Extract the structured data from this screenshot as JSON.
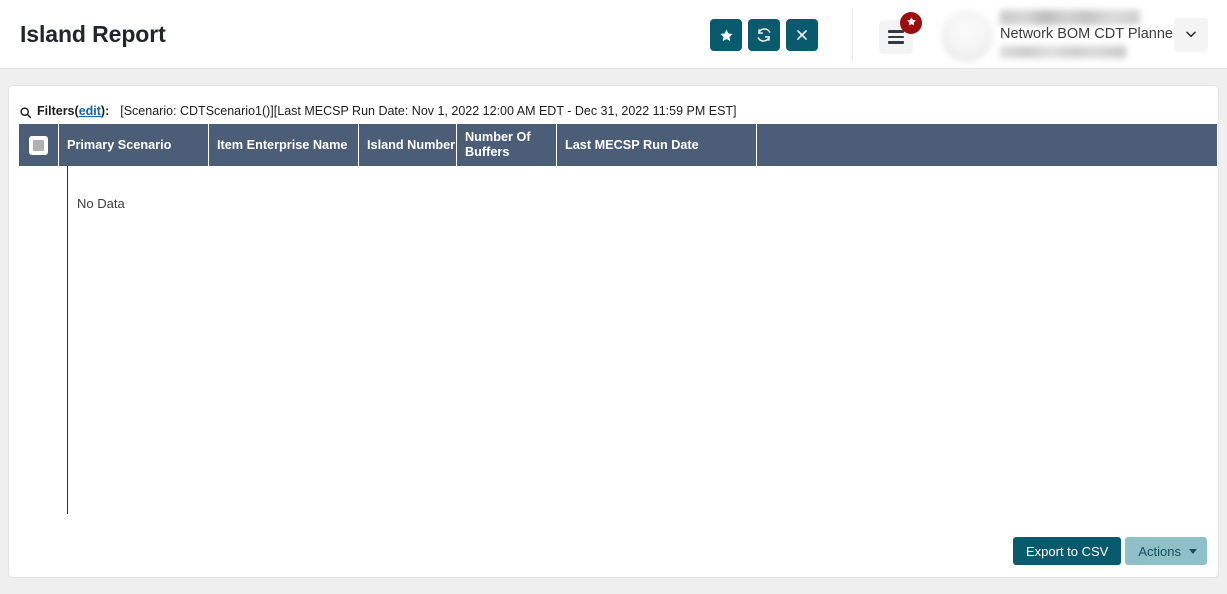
{
  "header": {
    "title": "Island Report",
    "icon_buttons": [
      {
        "name": "favorite-button",
        "icon": "star-icon",
        "label": ""
      },
      {
        "name": "refresh-button",
        "icon": "refresh-icon",
        "label": ""
      },
      {
        "name": "close-button",
        "icon": "close-icon",
        "label": ""
      }
    ],
    "menu": {
      "icon": "hamburger-menu-icon",
      "badge_icon": "star-icon"
    },
    "user": {
      "avatar_icon": "avatar-image",
      "name": "",
      "role": "Network BOM CDT Planner",
      "email": "",
      "dropdown_icon": "chevron-down-icon"
    },
    "accent_color": "#0a5a6e",
    "badge_color": "#9c0d10"
  },
  "filters": {
    "search_icon": "search-icon",
    "label": "Filters",
    "open_paren": "(",
    "edit_link": "edit",
    "close_paren": "):",
    "summary": "[Scenario: CDTScenario1()][Last MECSP Run Date: Nov 1, 2022 12:00 AM EDT - Dec 31, 2022 11:59 PM EST]"
  },
  "table": {
    "header_color": "#4b5d77",
    "select_all_checkbox": "select-all-checkbox",
    "columns": [
      "Primary Scenario",
      "Item Enterprise Name",
      "Island Number",
      "Number Of Buffers",
      "Last MECSP Run Date",
      ""
    ],
    "rows": [],
    "empty_message": "No Data"
  },
  "footer": {
    "export_label": "Export to CSV",
    "actions_label": "Actions",
    "actions_caret_icon": "caret-down-icon",
    "export_color": "#0a5a6e",
    "actions_color": "#8fbfc9"
  }
}
